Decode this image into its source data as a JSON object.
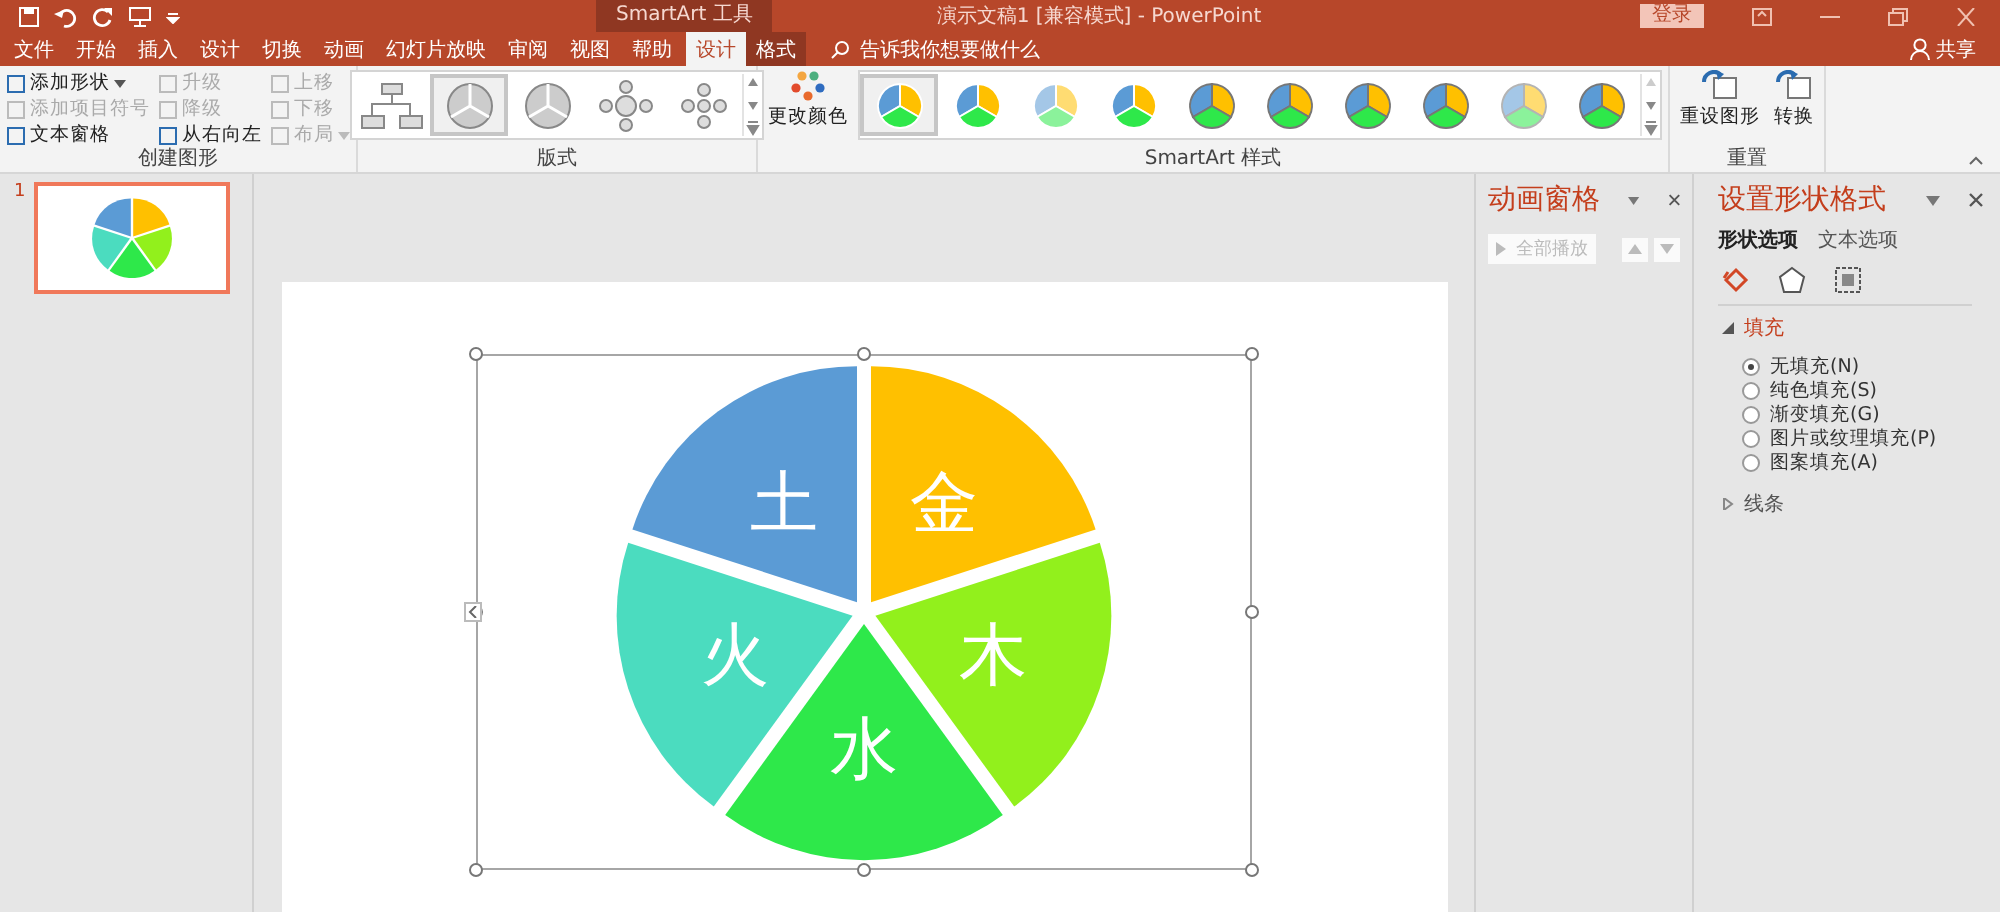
{
  "title_bar": {
    "context_label": "SmartArt 工具",
    "title": "演示文稿1 [兼容模式] - PowerPoint",
    "login_button": "登录"
  },
  "tabs": [
    {
      "label": "文件",
      "selected": false,
      "contextual": false
    },
    {
      "label": "开始",
      "selected": false,
      "contextual": false
    },
    {
      "label": "插入",
      "selected": false,
      "contextual": false
    },
    {
      "label": "设计",
      "selected": false,
      "contextual": false
    },
    {
      "label": "切换",
      "selected": false,
      "contextual": false
    },
    {
      "label": "动画",
      "selected": false,
      "contextual": false
    },
    {
      "label": "幻灯片放映",
      "selected": false,
      "contextual": false
    },
    {
      "label": "审阅",
      "selected": false,
      "contextual": false
    },
    {
      "label": "视图",
      "selected": false,
      "contextual": false
    },
    {
      "label": "帮助",
      "selected": false,
      "contextual": false
    },
    {
      "label": "设计",
      "selected": true,
      "contextual": true
    },
    {
      "label": "格式",
      "selected": false,
      "contextual": true
    }
  ],
  "tell_me": "告诉我你想要做什么",
  "share": "共享",
  "create_group": {
    "label": "创建图形",
    "columns": [
      [
        {
          "label": "添加形状",
          "disabled": false,
          "dropdown": true
        },
        {
          "label": "添加项目符号",
          "disabled": true,
          "dropdown": false
        },
        {
          "label": "文本窗格",
          "disabled": false,
          "dropdown": false
        }
      ],
      [
        {
          "label": "升级",
          "disabled": true,
          "dropdown": false
        },
        {
          "label": "降级",
          "disabled": true,
          "dropdown": false
        },
        {
          "label": "从右向左",
          "disabled": false,
          "dropdown": false
        }
      ],
      [
        {
          "label": "上移",
          "disabled": true,
          "dropdown": false
        },
        {
          "label": "下移",
          "disabled": true,
          "dropdown": false
        },
        {
          "label": "布局",
          "disabled": true,
          "dropdown": true
        }
      ]
    ]
  },
  "layout_group": {
    "label": "版式",
    "items": [
      {
        "selected": false
      },
      {
        "selected": true
      },
      {
        "selected": false
      },
      {
        "selected": false
      },
      {
        "selected": false
      }
    ]
  },
  "styles_group": {
    "label": "SmartArt 样式",
    "change_colors": "更改颜色",
    "items": [
      {
        "selected": true
      },
      {
        "selected": false
      },
      {
        "selected": false
      },
      {
        "selected": false
      },
      {
        "selected": false
      },
      {
        "selected": false
      },
      {
        "selected": false
      },
      {
        "selected": false
      },
      {
        "selected": false
      },
      {
        "selected": false
      }
    ]
  },
  "reset_group": {
    "label": "重置",
    "buttons": [
      "重设图形",
      "转换"
    ]
  },
  "slides": [
    {
      "number": "1",
      "selected": true
    }
  ],
  "diagram": {
    "segments": [
      {
        "label": "金",
        "color": "#ffc000"
      },
      {
        "label": "木",
        "color": "#92f01c"
      },
      {
        "label": "水",
        "color": "#2ee84a"
      },
      {
        "label": "火",
        "color": "#4bdcbf"
      },
      {
        "label": "土",
        "color": "#5b9bd5"
      }
    ]
  },
  "animation_pane": {
    "title": "动画窗格",
    "play_button": "全部播放",
    "play_disabled": true
  },
  "format_pane": {
    "title": "设置形状格式",
    "tabs": [
      {
        "label": "形状选项",
        "selected": true
      },
      {
        "label": "文本选项",
        "selected": false
      }
    ],
    "sections": [
      {
        "label": "填充",
        "expanded": true,
        "options": [
          {
            "label": "无填充(N)",
            "selected": true
          },
          {
            "label": "纯色填充(S)",
            "selected": false
          },
          {
            "label": "渐变填充(G)",
            "selected": false
          },
          {
            "label": "图片或纹理填充(P)",
            "selected": false
          },
          {
            "label": "图案填充(A)",
            "selected": false
          }
        ]
      },
      {
        "label": "线条",
        "expanded": false
      }
    ]
  }
}
